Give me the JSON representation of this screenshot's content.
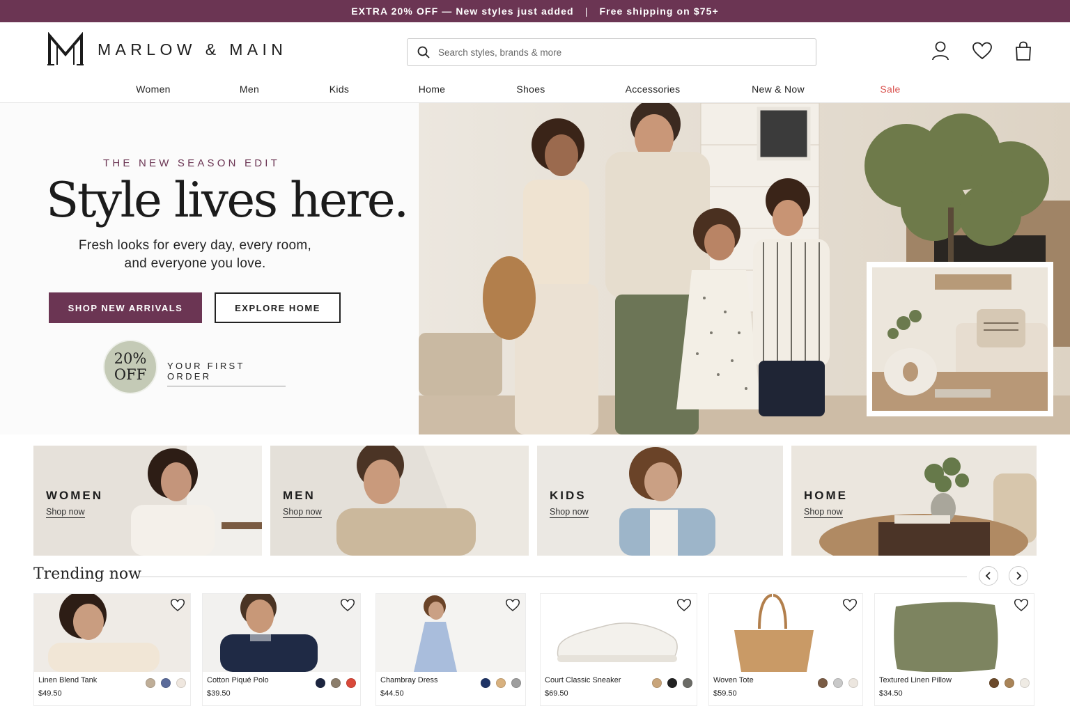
{
  "promo": {
    "left": "EXTRA 20% OFF — New styles just added",
    "separator": "|",
    "right": "Free shipping on $75+"
  },
  "header": {
    "brand": "MARLOW & MAIN",
    "search_placeholder": "Search styles, brands & more",
    "icons": [
      "account-icon",
      "heart-icon",
      "bag-icon"
    ]
  },
  "nav": {
    "items": [
      {
        "label": "Women"
      },
      {
        "label": "Men"
      },
      {
        "label": "Kids"
      },
      {
        "label": "Home"
      },
      {
        "label": "Shoes"
      },
      {
        "label": "Accessories"
      },
      {
        "label": "New & Now"
      },
      {
        "label": "Sale",
        "color": "#d9534f"
      }
    ]
  },
  "hero": {
    "eyebrow": "THE NEW SEASON EDIT",
    "headline": "Style lives here.",
    "subtitle_line1": "Fresh looks for every day, every room,",
    "subtitle_line2": "and everyone you love.",
    "primary_cta": "SHOP NEW ARRIVALS",
    "secondary_cta": "EXPLORE HOME",
    "badge_line1": "20%",
    "badge_line2": "OFF",
    "badge_text": "YOUR FIRST ORDER"
  },
  "categories": [
    {
      "name": "WOMEN",
      "link": "Shop now"
    },
    {
      "name": "MEN",
      "link": "Shop now"
    },
    {
      "name": "KIDS",
      "link": "Shop now"
    },
    {
      "name": "HOME",
      "link": "Shop now"
    }
  ],
  "trending": {
    "title": "Trending now",
    "products": [
      {
        "name": "Linen Blend Tank",
        "price": "$49.50",
        "swatches": [
          "#bfae98",
          "#5b6b9a",
          "#efe7df"
        ]
      },
      {
        "name": "Cotton Piqué Polo",
        "price": "$39.50",
        "swatches": [
          "#1c2540",
          "#8b7d6b",
          "#d9493a"
        ]
      },
      {
        "name": "Chambray Dress",
        "price": "$44.50",
        "swatches": [
          "#1f3466",
          "#d8b17f",
          "#9e9e9e"
        ]
      },
      {
        "name": "Court Classic Sneaker",
        "price": "$69.50",
        "swatches": [
          "#c9a57b",
          "#222222",
          "#6b6b66"
        ]
      },
      {
        "name": "Woven Tote",
        "price": "$59.50",
        "swatches": [
          "#7a5c45",
          "#c9c9c9",
          "#ece6df"
        ]
      },
      {
        "name": "Textured Linen Pillow",
        "price": "$34.50",
        "swatches": [
          "#6b4a2b",
          "#a98458",
          "#efebe4"
        ]
      }
    ]
  },
  "colors": {
    "brand_plum": "#6b3553",
    "sale_red": "#d9534f",
    "badge_sage": "#c4cab6"
  }
}
